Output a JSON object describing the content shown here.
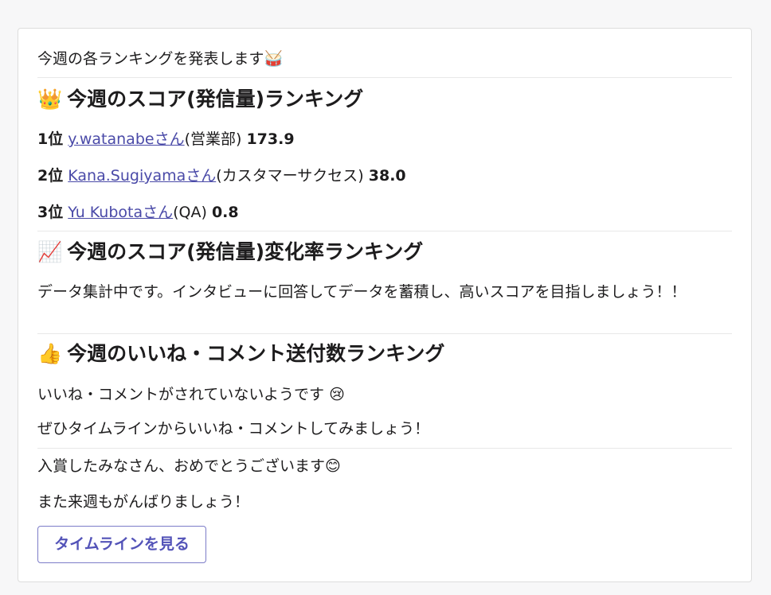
{
  "intro": {
    "text": "今週の各ランキングを発表します",
    "emoji": "🥁"
  },
  "score_section": {
    "emoji": "👑",
    "title": "今週のスコア(発信量)ランキング",
    "entries": [
      {
        "rank": "1位",
        "user": "y.watanabeさん",
        "dept": "(営業部)",
        "score": "173.9"
      },
      {
        "rank": "2位",
        "user": "Kana.Sugiyamaさん",
        "dept": "(カスタマーサクセス)",
        "score": "38.0"
      },
      {
        "rank": "3位",
        "user": "Yu Kubotaさん",
        "dept": "(QA)",
        "score": "0.8"
      }
    ]
  },
  "change_section": {
    "emoji": "📈",
    "title": "今週のスコア(発信量)変化率ランキング",
    "message": "データ集計中です。インタビューに回答してデータを蓄積し、高いスコアを目指しましょう！！"
  },
  "likes_section": {
    "emoji": "👍",
    "title": "今週のいいね・コメント送付数ランキング",
    "line1": "いいね・コメントがされていないようです",
    "line1_emoji": "😢",
    "line2": "ぜひタイムラインからいいね・コメントしてみましょう！"
  },
  "closing": {
    "line1": "入賞したみなさん、おめでとうございます",
    "line1_emoji": "😊",
    "line2": "また来週もがんばりましょう！"
  },
  "button": {
    "label": "タイムラインを見る"
  },
  "colors": {
    "link": "#4a4aa8",
    "button_text": "#5353b8",
    "button_border": "#7c7cc8"
  }
}
